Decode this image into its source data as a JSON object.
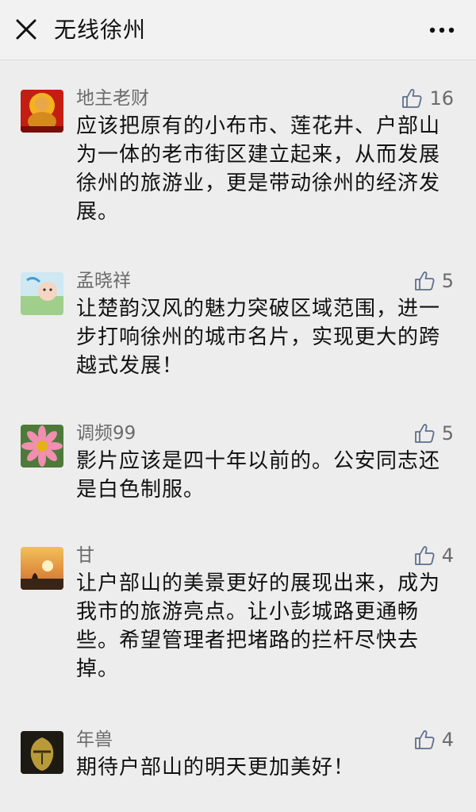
{
  "header": {
    "title": "无线徐州",
    "close_icon": "close-icon",
    "more_icon": "more-dots-icon"
  },
  "comments": [
    {
      "author": "地主老财",
      "likes": "16",
      "text": "应该把原有的小布市、莲花井、户部山为一体的老市街区建立起来，从而发展徐州的旅游业，更是带动徐州的经济发展。",
      "avatar_icon": "buddha-avatar-icon"
    },
    {
      "author": "孟晓祥",
      "likes": "5",
      "text": "让楚韵汉风的魅力突破区域范围，进一步打响徐州的城市名片，实现更大的跨越式发展！",
      "avatar_icon": "baby-avatar-icon"
    },
    {
      "author": "调频99",
      "likes": "5",
      "text": "影片应该是四十年以前的。公安同志还是白色制服。",
      "avatar_icon": "flower-avatar-icon"
    },
    {
      "author": "甘",
      "likes": "4",
      "text": "让户部山的美景更好的展现出来，成为我市的旅游亮点。让小彭城路更通畅些。希望管理者把堵路的拦杆尽快去掉。",
      "avatar_icon": "sunset-avatar-icon"
    },
    {
      "author": "年兽",
      "likes": "4",
      "text": "期待户部山的明天更加美好！",
      "avatar_icon": "mask-avatar-icon"
    }
  ],
  "colors": {
    "background": "#ededed",
    "header_bg": "#f2f2f2",
    "name_gray": "#6b6b6b",
    "text_black": "#111111"
  }
}
